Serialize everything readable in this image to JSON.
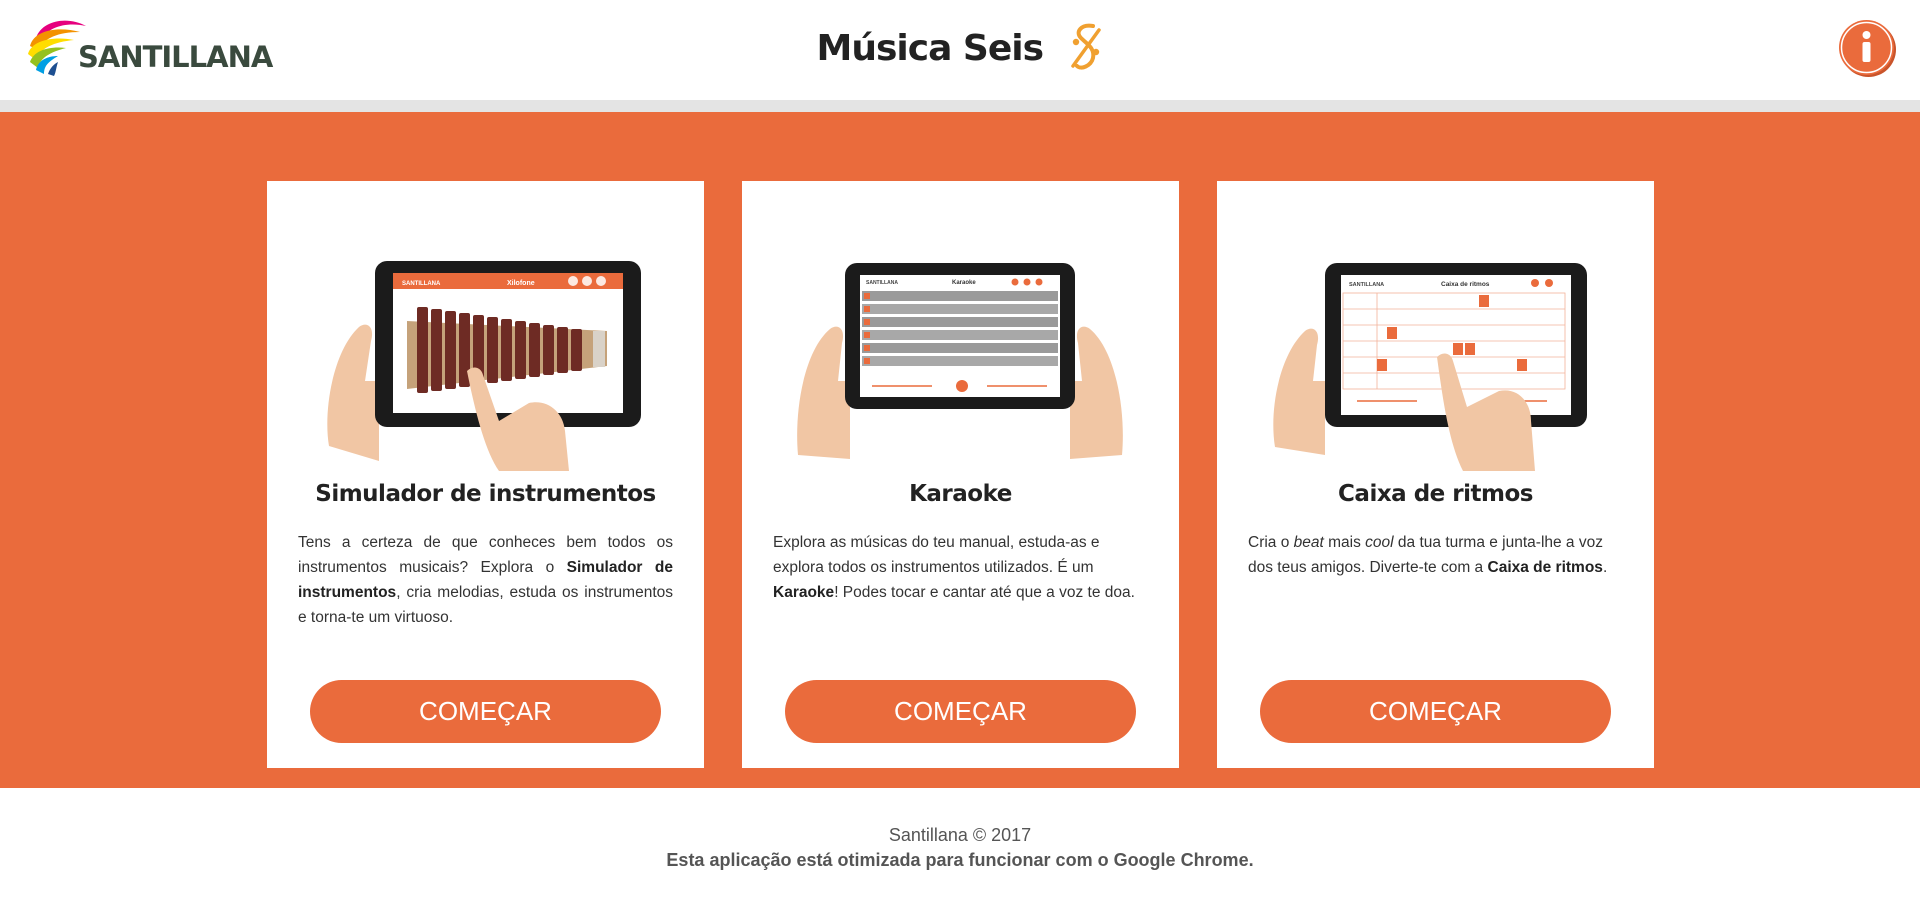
{
  "header": {
    "logo_text": "SANTILLANA",
    "title": "Música Seis",
    "title_icon": "segno-icon",
    "info_icon": "info-icon"
  },
  "colors": {
    "accent": "#ea6b3c",
    "background_main": "#ea6b3c",
    "card": "#ffffff",
    "button_text": "#ffffff"
  },
  "cards": [
    {
      "title": "Simulador de instrumentos",
      "desc": [
        {
          "text": "Tens a certeza de que conheces bem todos os instrumentos musicais? Explora o ",
          "style": "normal"
        },
        {
          "text": "Simulador de instrumentos",
          "style": "bold"
        },
        {
          "text": ", cria melodias, estuda os instrumentos e torna-te um virtuoso.",
          "style": "normal"
        }
      ],
      "button": "COMEÇAR",
      "screen_title": "Xilofone",
      "screen_brand": "SANTILLANA"
    },
    {
      "title": "Karaoke",
      "desc": [
        {
          "text": "Explora as músicas do teu manual, estuda-as e explora todos os instrumentos utilizados. É um ",
          "style": "normal"
        },
        {
          "text": "Karaoke",
          "style": "bold"
        },
        {
          "text": "! Podes tocar e cantar até que a voz te doa.",
          "style": "normal"
        }
      ],
      "button": "COMEÇAR",
      "screen_title": "Karaoke",
      "screen_brand": "SANTILLANA"
    },
    {
      "title": "Caixa de ritmos",
      "desc": [
        {
          "text": "Cria o ",
          "style": "normal"
        },
        {
          "text": "beat",
          "style": "italic"
        },
        {
          "text": " mais ",
          "style": "normal"
        },
        {
          "text": "cool",
          "style": "italic"
        },
        {
          "text": " da tua turma e junta-lhe a voz dos teus amigos. Diverte-te com a ",
          "style": "normal"
        },
        {
          "text": "Caixa de ritmos",
          "style": "bold"
        },
        {
          "text": ".",
          "style": "normal"
        }
      ],
      "button": "COMEÇAR",
      "screen_title": "Caixa de ritmos",
      "screen_brand": "SANTILLANA"
    }
  ],
  "footer": {
    "copyright": "Santillana © 2017",
    "browser_note": "Esta aplicação está otimizada para funcionar com o Google Chrome."
  }
}
